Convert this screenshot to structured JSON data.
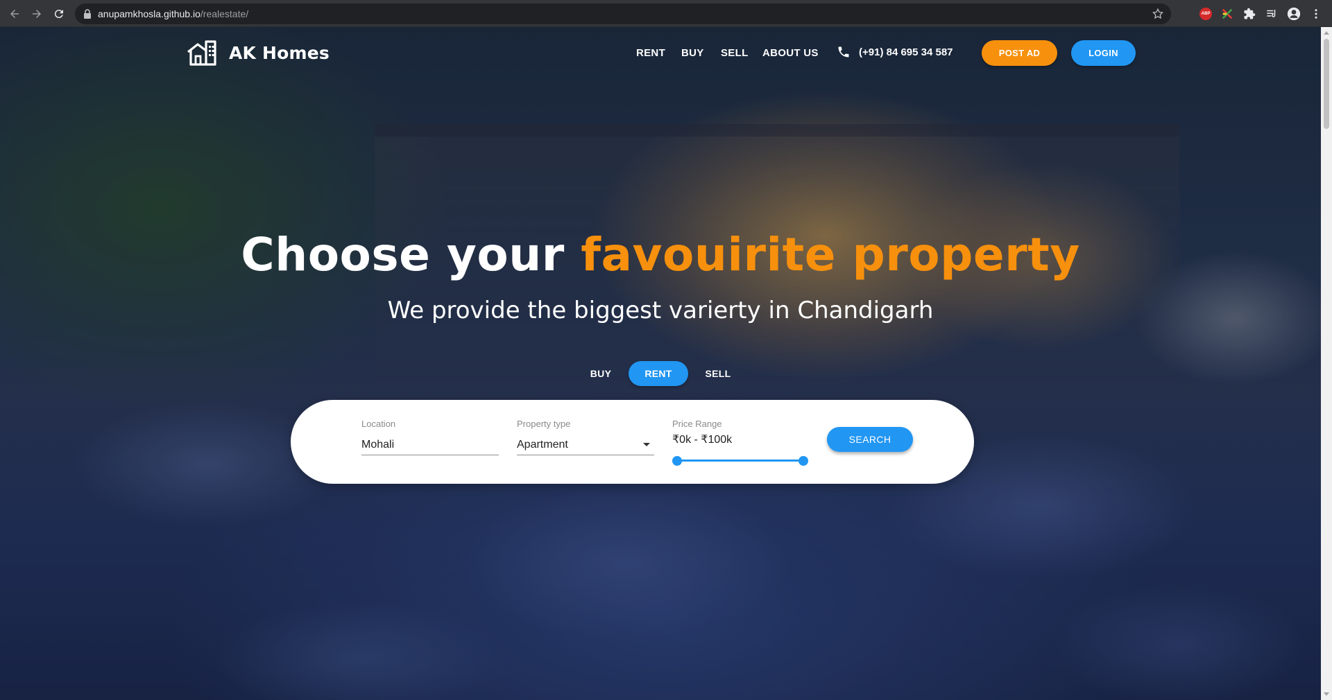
{
  "browser": {
    "url_host": "anupamkhosla.github.io",
    "url_path": "/realestate/",
    "extensions": [
      "abp-icon",
      "color-picker-icon",
      "puzzle-icon",
      "reading-list-icon",
      "profile-icon",
      "menu-icon"
    ],
    "abp_label": "ABP"
  },
  "site": {
    "brand": "AK Homes",
    "nav": [
      "RENT",
      "BUY",
      "SELL",
      "ABOUT US"
    ],
    "phone": "(+91) 84 695 34 587",
    "post_ad": "POST AD",
    "login": "LOGIN"
  },
  "hero": {
    "title_plain": "Choose your ",
    "title_accent": "favouirite property",
    "subtitle": "We provide the biggest varierty in Chandigarh"
  },
  "tabs": [
    {
      "label": "BUY",
      "active": false
    },
    {
      "label": "RENT",
      "active": true
    },
    {
      "label": "SELL",
      "active": false
    }
  ],
  "search": {
    "location_label": "Location",
    "location_value": "Mohali",
    "type_label": "Property type",
    "type_value": "Apartment",
    "price_label": "Price Range",
    "price_value": "₹0k - ₹100k",
    "price_range_fraction": [
      0,
      1
    ],
    "button": "SEARCH"
  },
  "colors": {
    "accent_orange": "#f7900d",
    "primary_blue": "#2196f3"
  }
}
